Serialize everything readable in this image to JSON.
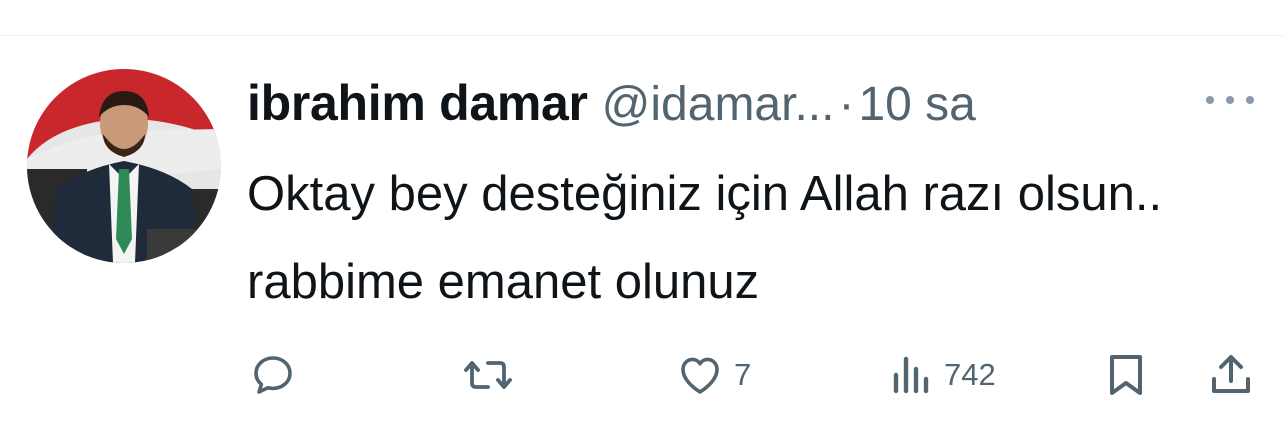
{
  "tweet": {
    "author_name": "ibrahim damar",
    "handle": "@idamar...",
    "separator": "·",
    "time": "10 sa",
    "text": "Oktay bey desteğiniz için Allah razı olsun.. rabbime emanet olunuz"
  },
  "actions": {
    "reply": {
      "icon": "reply-icon",
      "count": ""
    },
    "retweet": {
      "icon": "retweet-icon",
      "count": ""
    },
    "like": {
      "icon": "heart-icon",
      "count": "7"
    },
    "views": {
      "icon": "views-icon",
      "count": "742"
    },
    "bookmark": {
      "icon": "bookmark-icon"
    },
    "share": {
      "icon": "share-icon"
    }
  },
  "colors": {
    "text_primary": "#0f1419",
    "text_secondary": "#536471",
    "divider": "#eff3f4"
  }
}
